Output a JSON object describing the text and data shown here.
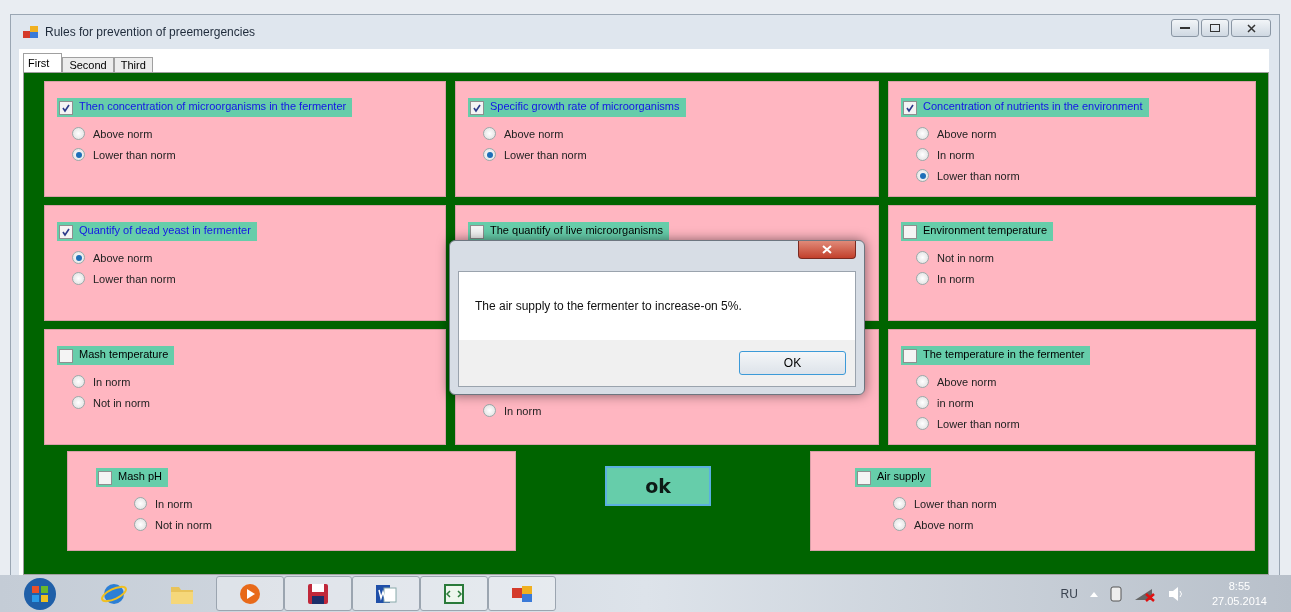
{
  "window": {
    "title": "Rules for prevention of preemergencies"
  },
  "tabs": [
    {
      "label": "First",
      "selected": true
    },
    {
      "label": "Second",
      "selected": false
    },
    {
      "label": "Third",
      "selected": false
    }
  ],
  "panels": [
    {
      "checkbox": {
        "label": "Then concentration  of microorganisms in the fermenter",
        "checked": true
      },
      "options": [
        {
          "label": "Above norm",
          "selected": false
        },
        {
          "label": "Lower than norm",
          "selected": true
        }
      ]
    },
    {
      "checkbox": {
        "label": "Specific growth rate of microorganisms",
        "checked": true
      },
      "options": [
        {
          "label": "Above norm",
          "selected": false
        },
        {
          "label": "Lower than norm",
          "selected": true
        }
      ]
    },
    {
      "checkbox": {
        "label": "Concentration of nutrients in the environment",
        "checked": true
      },
      "options": [
        {
          "label": "Above norm",
          "selected": false
        },
        {
          "label": "In norm",
          "selected": false
        },
        {
          "label": "Lower than norm",
          "selected": true
        }
      ]
    },
    {
      "checkbox": {
        "label": "Quantify of dead yeast in fermenter",
        "checked": true
      },
      "options": [
        {
          "label": "Above norm",
          "selected": true
        },
        {
          "label": "Lower than norm",
          "selected": false
        }
      ]
    },
    {
      "checkbox": {
        "label": "The quantify of live microorganisms",
        "checked": false
      }
    },
    {
      "checkbox": {
        "label": "Environment temperature",
        "checked": false
      },
      "options": [
        {
          "label": "Not in norm",
          "selected": false
        },
        {
          "label": "In norm",
          "selected": false
        }
      ]
    },
    {
      "checkbox": {
        "label": "Mash temperature",
        "checked": false
      },
      "options": [
        {
          "label": "In norm",
          "selected": false
        },
        {
          "label": "Not in norm",
          "selected": false
        }
      ]
    },
    {
      "options": [
        {
          "label": "In norm",
          "selected": false
        }
      ]
    },
    {
      "checkbox": {
        "label": "The temperature in the fermenter",
        "checked": false
      },
      "options": [
        {
          "label": "Above norm",
          "selected": false
        },
        {
          "label": "in norm",
          "selected": false
        },
        {
          "label": "Lower than norm",
          "selected": false
        }
      ]
    }
  ],
  "bottom_panels": [
    {
      "checkbox": {
        "label": "Mash pH",
        "checked": false
      },
      "options": [
        {
          "label": "In norm",
          "selected": false
        },
        {
          "label": "Not in norm",
          "selected": false
        }
      ]
    },
    {
      "checkbox": {
        "label": "Air supply",
        "checked": false
      },
      "options": [
        {
          "label": "Lower than norm",
          "selected": false
        },
        {
          "label": "Above norm",
          "selected": false
        }
      ]
    }
  ],
  "ok_button": "ok",
  "dialog": {
    "message": "The air supply to the fermenter to increase-on 5%.",
    "button": "OK"
  },
  "taskbar": {
    "language": "RU",
    "time": "8:55",
    "date": "27.05.2014"
  }
}
